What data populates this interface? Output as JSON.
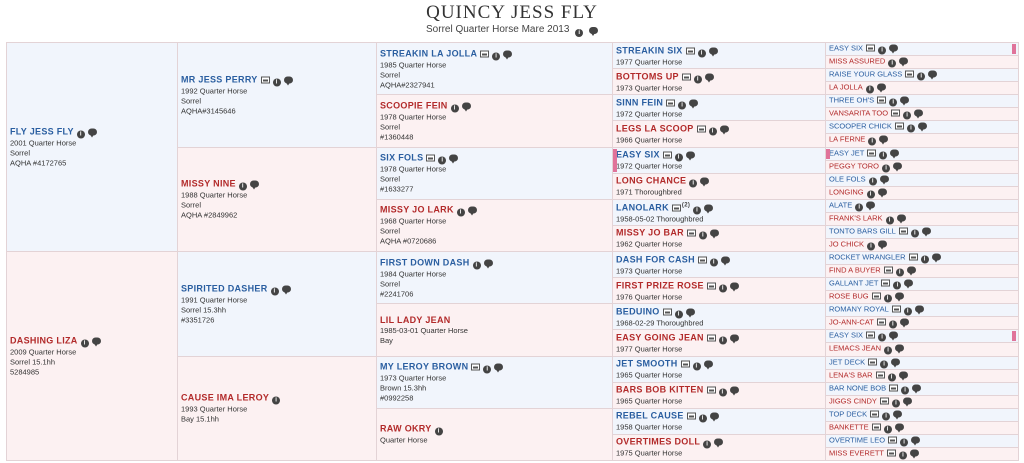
{
  "header": {
    "title": "QUINCY JESS FLY",
    "subtitle": "Sorrel Quarter Horse Mare 2013"
  },
  "pedigree": {
    "g1": [
      {
        "name": "FLY JESS FLY",
        "lines": [
          "2001 Quarter Horse",
          "Sorrel",
          "AQHA #4172765"
        ]
      },
      {
        "name": "DASHING LIZA",
        "lines": [
          "2009 Quarter Horse",
          "Sorrel 15.1hh",
          "5284985"
        ]
      }
    ],
    "g2": [
      {
        "name": "MR JESS PERRY",
        "lines": [
          "1992 Quarter Horse",
          "Sorrel",
          "AQHA#3145646"
        ]
      },
      {
        "name": "MISSY NINE",
        "lines": [
          "1988 Quarter Horse",
          "Sorrel",
          "AQHA #2849962"
        ]
      },
      {
        "name": "SPIRITED DASHER",
        "lines": [
          "1991 Quarter Horse",
          "Sorrel 15.3hh",
          "#3351726"
        ]
      },
      {
        "name": "CAUSE IMA LEROY",
        "lines": [
          "1993 Quarter Horse",
          "Bay 15.1hh"
        ]
      }
    ],
    "g3": [
      {
        "name": "STREAKIN LA JOLLA",
        "lines": [
          "1985 Quarter Horse",
          "Sorrel",
          "AQHA#2327941"
        ]
      },
      {
        "name": "SCOOPIE FEIN",
        "lines": [
          "1978 Quarter Horse",
          "Sorrel",
          "#1360448"
        ]
      },
      {
        "name": "SIX FOLS",
        "lines": [
          "1978 Quarter Horse",
          "Sorrel",
          "#1633277"
        ]
      },
      {
        "name": "MISSY JO LARK",
        "lines": [
          "1968 Quarter Horse",
          "Sorrel",
          "AQHA #0720686"
        ]
      },
      {
        "name": "FIRST DOWN DASH",
        "lines": [
          "1984 Quarter Horse",
          "Sorrel",
          "#2241706"
        ]
      },
      {
        "name": "LIL LADY JEAN",
        "lines": [
          "1985-03-01 Quarter Horse",
          "Bay"
        ]
      },
      {
        "name": "MY LEROY BROWN",
        "lines": [
          "1973 Quarter Horse",
          "Brown 15.3hh",
          "#0992258"
        ]
      },
      {
        "name": "RAW OKRY",
        "lines": [
          "Quarter Horse"
        ]
      }
    ],
    "g4": [
      {
        "name": "STREAKIN SIX",
        "lines": [
          "1977 Quarter Horse"
        ]
      },
      {
        "name": "BOTTOMS UP",
        "lines": [
          "1973 Quarter Horse"
        ]
      },
      {
        "name": "SINN FEIN",
        "lines": [
          "1972 Quarter Horse"
        ]
      },
      {
        "name": "LEGS LA SCOOP",
        "lines": [
          "1966 Quarter Horse"
        ]
      },
      {
        "name": "EASY SIX",
        "lines": [
          "1972 Quarter Horse"
        ]
      },
      {
        "name": "LONG CHANCE",
        "lines": [
          "1971 Thoroughbred"
        ]
      },
      {
        "name": "LANOLARK",
        "sup": "(2)",
        "lines": [
          "1958-05-02 Thoroughbred"
        ]
      },
      {
        "name": "MISSY JO BAR",
        "lines": [
          "1962 Quarter Horse"
        ]
      },
      {
        "name": "DASH FOR CASH",
        "lines": [
          "1973 Quarter Horse"
        ]
      },
      {
        "name": "FIRST PRIZE ROSE",
        "lines": [
          "1976 Quarter Horse"
        ]
      },
      {
        "name": "BEDUINO",
        "lines": [
          "1968-02-29 Thoroughbred"
        ]
      },
      {
        "name": "EASY GOING JEAN",
        "lines": [
          "1977 Quarter Horse"
        ]
      },
      {
        "name": "JET SMOOTH",
        "lines": [
          "1965 Quarter Horse"
        ]
      },
      {
        "name": "BARS BOB KITTEN",
        "lines": [
          "1965 Quarter Horse"
        ]
      },
      {
        "name": "REBEL CAUSE",
        "lines": [
          "1958 Quarter Horse"
        ]
      },
      {
        "name": "OVERTIMES DOLL",
        "lines": [
          "1975 Quarter Horse"
        ]
      }
    ],
    "g5": [
      {
        "name": "EASY SIX"
      },
      {
        "name": "MISS ASSURED"
      },
      {
        "name": "RAISE YOUR GLASS"
      },
      {
        "name": "LA JOLLA"
      },
      {
        "name": "THREE OH'S"
      },
      {
        "name": "VANSARITA TOO"
      },
      {
        "name": "SCOOPER CHICK"
      },
      {
        "name": "LA FERNE"
      },
      {
        "name": "EASY JET"
      },
      {
        "name": "PEGGY TORO"
      },
      {
        "name": "OLE FOLS"
      },
      {
        "name": "LONGING"
      },
      {
        "name": "ALATE"
      },
      {
        "name": "FRANK'S LARK"
      },
      {
        "name": "TONTO BARS GILL"
      },
      {
        "name": "JO CHICK"
      },
      {
        "name": "ROCKET WRANGLER"
      },
      {
        "name": "FIND A BUYER"
      },
      {
        "name": "GALLANT JET"
      },
      {
        "name": "ROSE BUG"
      },
      {
        "name": "ROMANY ROYAL"
      },
      {
        "name": "JO-ANN-CAT"
      },
      {
        "name": "EASY SIX"
      },
      {
        "name": "LEMACS JEAN"
      },
      {
        "name": "JET DECK"
      },
      {
        "name": "LENA'S BAR"
      },
      {
        "name": "BAR NONE BOB"
      },
      {
        "name": "JIGGS CINDY"
      },
      {
        "name": "TOP DECK"
      },
      {
        "name": "BANKETTE"
      },
      {
        "name": "OVERTIME LEO"
      },
      {
        "name": "MISS EVERETT"
      }
    ]
  },
  "icons": {
    "photo": "photo-icon",
    "info": "info-icon",
    "comment": "comment-icon",
    "info_glyph": "i"
  },
  "colors": {
    "sire_text": "#2a5ea0",
    "dam_text": "#b22a2a",
    "sire_bg": "#f1f5fc",
    "dam_bg": "#fcf1f2",
    "duplicate_marker": "#e0739a"
  }
}
